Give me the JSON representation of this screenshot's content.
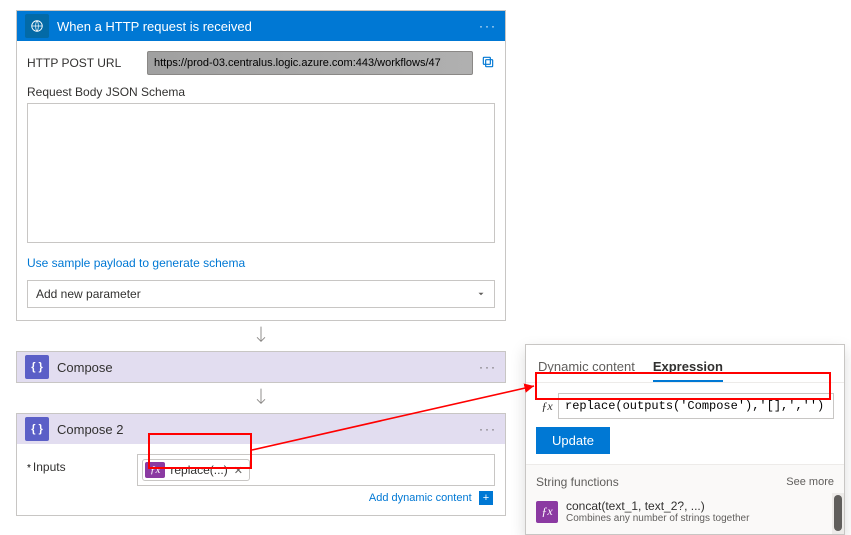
{
  "trigger": {
    "title": "When a HTTP request is received",
    "post_url_label": "HTTP POST URL",
    "post_url_value": "https://prod-03.centralus.logic.azure.com:443/workflows/47",
    "schema_label": "Request Body JSON Schema",
    "schema_value": "",
    "sample_link": "Use sample payload to generate schema",
    "add_parameter": "Add new parameter"
  },
  "compose1": {
    "title": "Compose"
  },
  "compose2": {
    "title": "Compose 2",
    "inputs_label": "Inputs",
    "token_text": "replace(...)",
    "dyn_link": "Add dynamic content"
  },
  "popout": {
    "tabs": {
      "dynamic": "Dynamic content",
      "expression": "Expression"
    },
    "expression_value": "replace(outputs('Compose'),'[],','')",
    "update": "Update",
    "fn_section_title": "String functions",
    "see_more": "See more",
    "fn_sig": "concat(text_1, text_2?, ...)",
    "fn_desc": "Combines any number of strings together"
  },
  "glyph": {
    "fx": "ƒx",
    "fx_small": "ƒx",
    "braces": "{ }",
    "dots": "···",
    "plus": "+",
    "close": "✕"
  }
}
